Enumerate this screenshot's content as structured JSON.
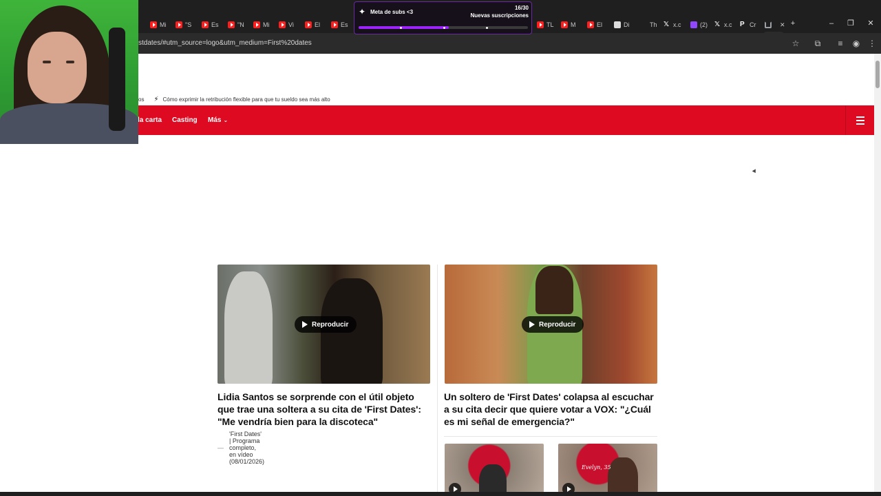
{
  "browser": {
    "tabs": [
      {
        "label": "Mi",
        "icon": "youtube-icon"
      },
      {
        "label": "\"S",
        "icon": "youtube-icon"
      },
      {
        "label": "Es",
        "icon": "youtube-icon"
      },
      {
        "label": "\"N",
        "icon": "youtube-icon"
      },
      {
        "label": "Mi",
        "icon": "youtube-icon"
      },
      {
        "label": "Vi",
        "icon": "youtube-icon"
      },
      {
        "label": "El",
        "icon": "youtube-icon"
      },
      {
        "label": "Es",
        "icon": "youtube-icon"
      },
      {
        "label": "TL",
        "icon": "youtube-icon"
      },
      {
        "label": "M",
        "icon": "youtube-icon"
      },
      {
        "label": "El",
        "icon": "youtube-icon"
      },
      {
        "label": "Di",
        "icon": "document-icon"
      },
      {
        "label": "Th",
        "icon": "blank-icon"
      },
      {
        "label": "x.c",
        "icon": "x-icon"
      },
      {
        "label": "(2)",
        "icon": "twitch-icon"
      },
      {
        "label": "x.c",
        "icon": "x-icon"
      },
      {
        "label": "Cr",
        "icon": "p-icon"
      },
      {
        "label": "",
        "icon": "loading-icon"
      }
    ],
    "address": "stdates/#utm_source=logo&utm_medium=First%20dates"
  },
  "ticker": {
    "left_fragment": "os",
    "item": "Cómo exprimir la retribución flexible para que tu sueldo sea más alto"
  },
  "nav": {
    "items": [
      "la carta",
      "Casting"
    ],
    "more_label": "Más"
  },
  "articles": [
    {
      "play_label": "Reproducir",
      "headline": "Lidia Santos se sorprende con el útil objeto que trae una soltera a su cita de 'First Dates': \"Me vendría bien para la discoteca\"",
      "meta": "'First Dates' | Programa completo, en vídeo (08/01/2026)"
    },
    {
      "play_label": "Reproducir",
      "headline": "Un soltero de 'First Dates' colapsa al escuchar a su cita decir que quiere votar a VOX: \"¿Cuál es mi señal de emergencia?\""
    }
  ],
  "small_thumbs": [
    {
      "caption": ""
    },
    {
      "caption": "Evelyn, 35"
    }
  ],
  "overlay": {
    "title": "Meta de subs <3",
    "count": "16/30",
    "subtitle": "Nuevas suscripciones",
    "progress": 0.5333,
    "accent": "#9b24ff"
  },
  "colors": {
    "brand_red": "#dd0a22",
    "chrome_dark": "#1f1f1f"
  }
}
